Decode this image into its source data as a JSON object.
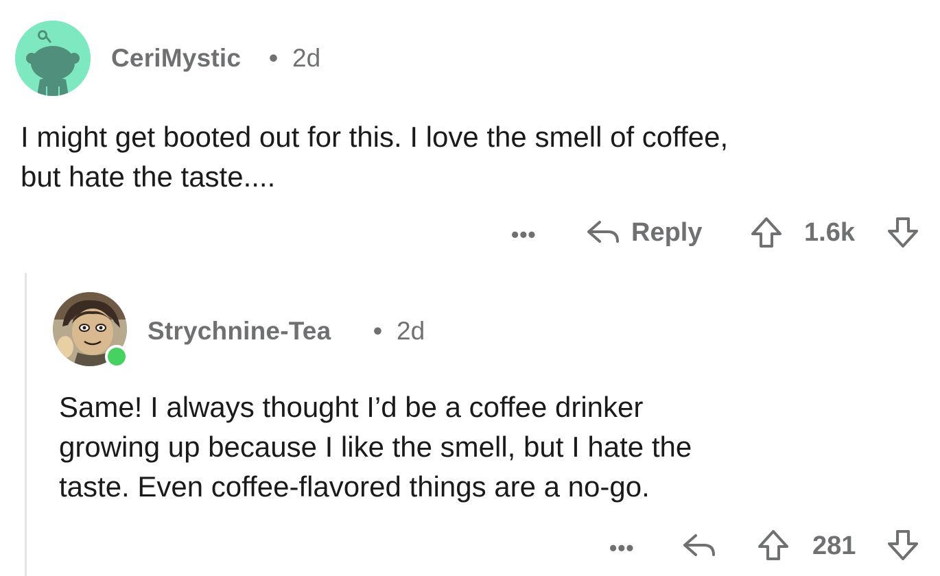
{
  "comments": [
    {
      "username": "CeriMystic",
      "separator": "•",
      "age": "2d",
      "body_lines": [
        "I might get booted out for this. I love the smell of coffee,",
        "but hate the taste...."
      ],
      "more": "•••",
      "reply_label": "Reply",
      "score": "1.6k",
      "avatar_color": "#7ee8c0"
    },
    {
      "username": "Strychnine-Tea",
      "separator": "•",
      "age": "2d",
      "body_lines": [
        "Same! I always thought I’d be a coffee drinker",
        "growing up because I like the smell, but I hate the",
        "taste. Even coffee-flavored things are a no-go."
      ],
      "more": "•••",
      "score": "281",
      "online_color": "#46d160"
    }
  ],
  "colors": {
    "meta_text": "#6f7071",
    "body_text": "#1a1a1b",
    "thread_line": "#e4e5e6"
  }
}
